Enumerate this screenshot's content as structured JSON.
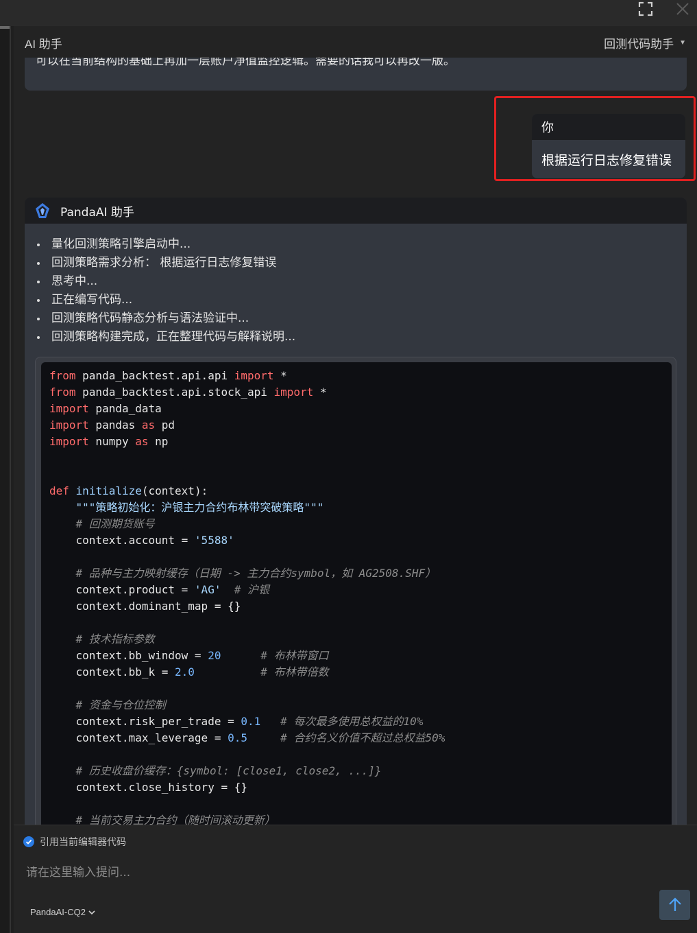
{
  "panel": {
    "title": "AI 助手",
    "mode_select": "回测代码助手"
  },
  "chat": {
    "previous_message_tail": "可以在当前结构的基础上再加一层账户净值监控逻辑。需要的话我可以再改一版。",
    "user_message": {
      "author": "你",
      "text": "根据运行日志修复错误"
    },
    "ai_message": {
      "author": "PandaAI 助手",
      "steps": [
        "量化回测策略引擎启动中...",
        "回测策略需求分析： 根据运行日志修复错误",
        "思考中...",
        "正在编写代码...",
        "回测策略代码静态分析与语法验证中...",
        "回测策略构建完成，正在整理代码与解释说明..."
      ],
      "code": {
        "imports": [
          {
            "kw1": "from",
            "module": " panda_backtest.api.api ",
            "kw2": "import",
            "rest": " *"
          },
          {
            "kw1": "from",
            "module": " panda_backtest.api.stock_api ",
            "kw2": "import",
            "rest": " *"
          },
          {
            "kw1": "import",
            "module": " panda_data",
            "kw2": "",
            "rest": ""
          },
          {
            "kw1": "import",
            "module": " pandas ",
            "kw2": "as",
            "rest": " pd"
          },
          {
            "kw1": "import",
            "module": " numpy ",
            "kw2": "as",
            "rest": " np"
          }
        ],
        "def_keyword": "def",
        "func_name": "initialize",
        "func_params": "(context):",
        "docstring": "\"\"\"策略初始化：沪银主力合约布林带突破策略\"\"\"",
        "comment_account": "# 回测期货账号",
        "account_lhs": "context.account = ",
        "account_value": "'5588'",
        "comment_product": "# 品种与主力映射缓存（日期 -> 主力合约symbol，如 AG2508.SHF）",
        "product_lhs": "context.product = ",
        "product_value": "'AG'",
        "product_comment": "# 沪银",
        "dominant_line": "context.dominant_map = {}",
        "comment_indicators": "# 技术指标参数",
        "bb_window_lhs": "context.bb_window = ",
        "bb_window_value": "20",
        "bb_window_comment": "# 布林带窗口",
        "bb_k_lhs": "context.bb_k = ",
        "bb_k_value": "2.0",
        "bb_k_comment": "# 布林带倍数",
        "comment_capital": "# 资金与仓位控制",
        "risk_lhs": "context.risk_per_trade = ",
        "risk_value": "0.1",
        "risk_comment": "# 每次最多使用总权益的10%",
        "leverage_lhs": "context.max_leverage = ",
        "leverage_value": "0.5",
        "leverage_comment": "# 合约名义价值不超过总权益50%",
        "comment_history": "# 历史收盘价缓存：{symbol: [close1, close2, ...]}",
        "history_line": "context.close_history = {}",
        "comment_current": "# 当前交易主力合约（随时间滚动更新）"
      }
    }
  },
  "composer": {
    "reference_label": "引用当前编辑器代码",
    "placeholder": "请在这里输入提问...",
    "model": "PandaAI-CQ2"
  }
}
